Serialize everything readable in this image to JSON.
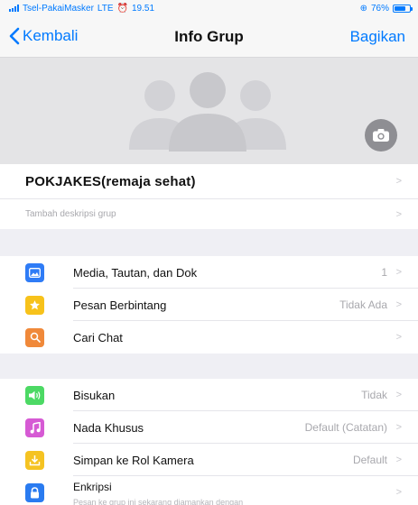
{
  "status_bar": {
    "carrier": "Tsel-PakaiMasker",
    "network": "LTE",
    "time": "19.51",
    "battery": "76%",
    "battery_level": 0.76
  },
  "nav": {
    "back_label": "Kembali",
    "title": "Info Grup",
    "share_label": "Bagikan"
  },
  "group": {
    "name": "POKJAKES(remaja sehat)",
    "description_placeholder": "Tambah deskripsi grup"
  },
  "media_section": [
    {
      "label": "Media, Tautan, dan Dok",
      "value": "1",
      "icon": "photo-icon",
      "color": "#2f7cf6"
    },
    {
      "label": "Pesan Berbintang",
      "value": "Tidak Ada",
      "icon": "star-icon",
      "color": "#f7c21b"
    },
    {
      "label": "Cari Chat",
      "value": "",
      "icon": "search-icon",
      "color": "#f0893a"
    }
  ],
  "settings_section": [
    {
      "label": "Bisukan",
      "value": "Tidak",
      "icon": "speaker-icon",
      "color": "#4cd964"
    },
    {
      "label": "Nada Khusus",
      "value": "Default (Catatan)",
      "icon": "music-note-icon",
      "color": "#d65ad4"
    },
    {
      "label": "Simpan ke Rol Kamera",
      "value": "Default",
      "icon": "save-download-icon",
      "color": "#f5c322"
    },
    {
      "label": "Enkripsi",
      "subtitle": "Pesan ke grup ini sekarang diamankan dengan",
      "value": "",
      "icon": "lock-icon",
      "color": "#2a7bf0"
    }
  ],
  "chevron": ">"
}
